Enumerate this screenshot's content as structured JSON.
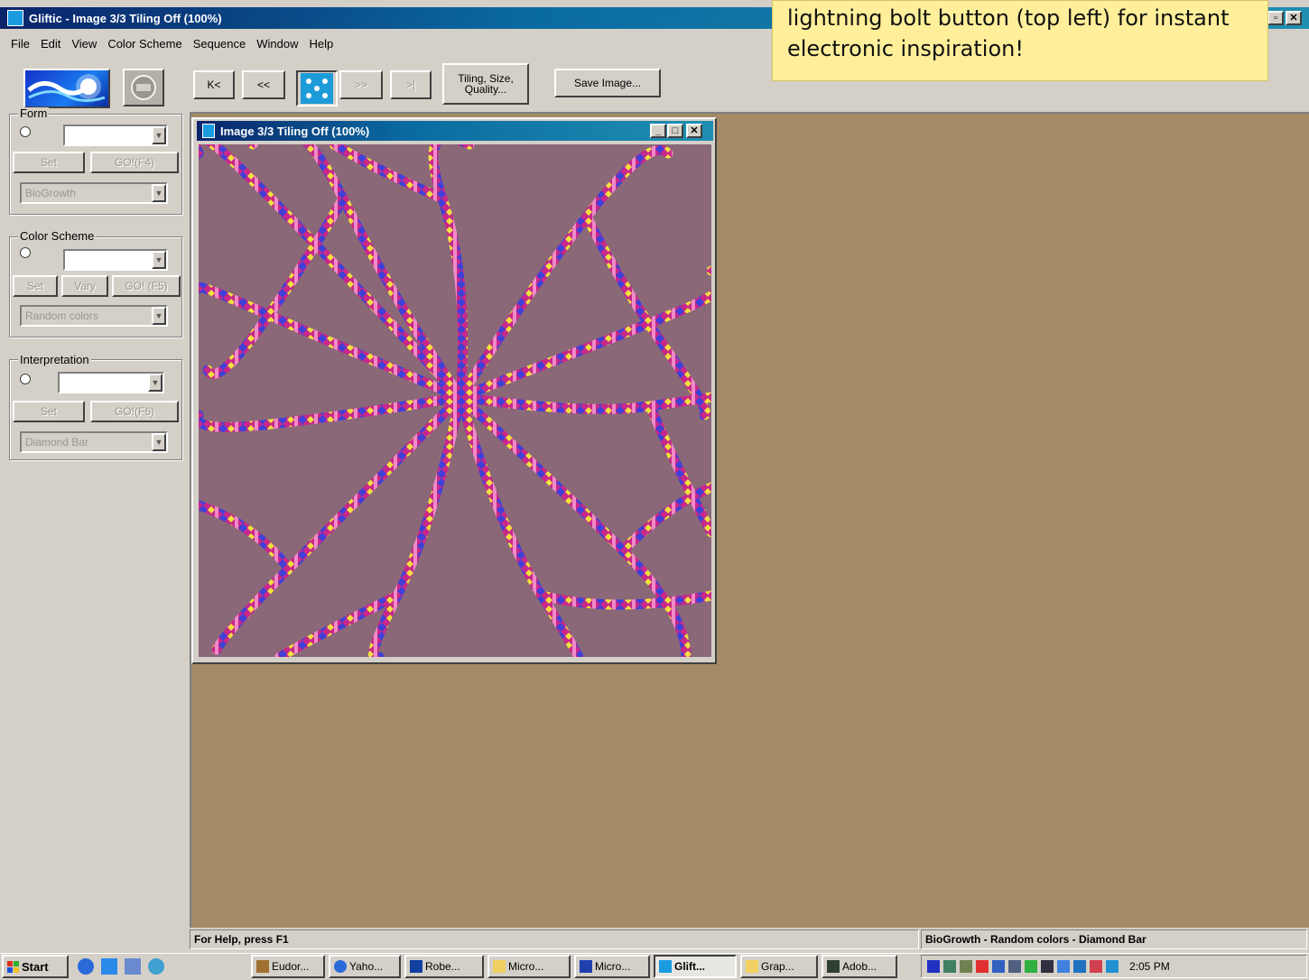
{
  "app": {
    "title": "Gliftic - Image 3/3 Tiling Off (100%)",
    "menu": [
      "File",
      "Edit",
      "View",
      "Color Scheme",
      "Sequence",
      "Window",
      "Help"
    ]
  },
  "callout": {
    "text": "lightning bolt button (top left) for instant electronic inspiration!"
  },
  "toolbar": {
    "first_label": "K<",
    "prev_label": "<<",
    "next_label": ">>",
    "last_label": ">|",
    "tiling_label": "Tiling, Size, Quality...",
    "save_label": "Save Image..."
  },
  "panels": {
    "form": {
      "label": "Form",
      "set_label": "Set",
      "go_label": "GO!(F4)",
      "selected": "BioGrowth"
    },
    "color_scheme": {
      "label": "Color Scheme",
      "set_label": "Set",
      "vary_label": "Vary",
      "go_label": "GO! (F5)",
      "selected": "Random colors"
    },
    "interpretation": {
      "label": "Interpretation",
      "set_label": "Set",
      "go_label": "GO!(F6)",
      "selected": "Diamond Bar"
    }
  },
  "child_window": {
    "title": "Image 3/3 Tiling Off (100%)"
  },
  "status": {
    "help": "For Help, press F1",
    "summary": "BioGrowth - Random colors - Diamond Bar"
  },
  "taskbar": {
    "start_label": "Start",
    "tasks": [
      "Eudor...",
      "Yaho...",
      "Robe...",
      "Micro...",
      "Micro...",
      "Glift...",
      "Grap...",
      "Adob..."
    ],
    "active_index": 5,
    "clock": "2:05 PM"
  },
  "colors": {
    "mdi_background": "#a48a66",
    "canvas_background": "#8a6878",
    "titlebar": "#0a246a",
    "callout": "#ffef9a"
  }
}
